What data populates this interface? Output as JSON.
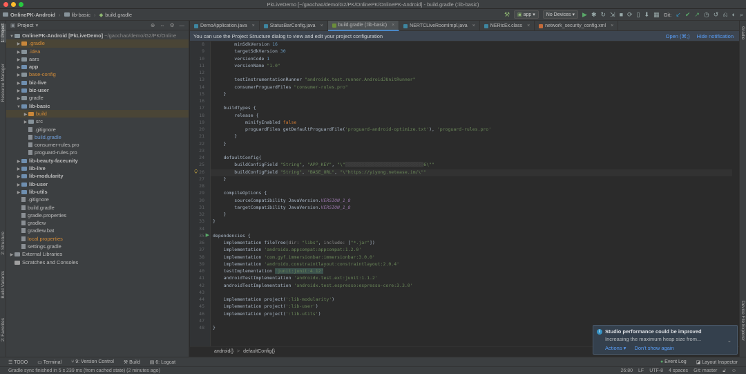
{
  "window": {
    "title": "PkLiveDemo [~/gaochao/demo/G2/PK/OnlinePK/OnlinePK-Android] - build.gradle (:lib-basic)"
  },
  "navbar": {
    "breadcrumbs": [
      "OnlinePK-Android",
      "lib-basic",
      "build.gradle"
    ],
    "run_config": "app",
    "device": "No Devices",
    "git_label": "Git:"
  },
  "left_tool_tabs": [
    "1: Project",
    "Resource Manager",
    "2: Structure",
    "Build Variants",
    "2: Favorites"
  ],
  "right_tool_tabs": [
    "Gradle",
    "Device File Explorer"
  ],
  "project": {
    "header": "Project",
    "tree": [
      {
        "indent": 0,
        "tw": "▼",
        "icon": "folder",
        "label": "OnlinePK-Android [PkLiveDemo]",
        "suffix": "~/gaochao/demo/G2/PK/Online",
        "bold": true
      },
      {
        "indent": 1,
        "tw": "▶",
        "icon": "folder-orange",
        "label": ".gradle",
        "orange": true,
        "highlight": true
      },
      {
        "indent": 1,
        "tw": "▶",
        "icon": "folder",
        "label": ".idea",
        "orange": true
      },
      {
        "indent": 1,
        "tw": "▶",
        "icon": "folder",
        "label": "aars"
      },
      {
        "indent": 1,
        "tw": "▶",
        "icon": "module",
        "label": "app",
        "bold": true
      },
      {
        "indent": 1,
        "tw": "▶",
        "icon": "folder",
        "label": "base-config",
        "orange": true
      },
      {
        "indent": 1,
        "tw": "▶",
        "icon": "module",
        "label": "biz-live",
        "bold": true
      },
      {
        "indent": 1,
        "tw": "▶",
        "icon": "module",
        "label": "biz-user",
        "bold": true
      },
      {
        "indent": 1,
        "tw": "▶",
        "icon": "folder",
        "label": "gradle"
      },
      {
        "indent": 1,
        "tw": "▼",
        "icon": "module",
        "label": "lib-basic",
        "bold": true
      },
      {
        "indent": 2,
        "tw": "▶",
        "icon": "folder-orange",
        "label": "build",
        "orange": true,
        "highlight": true
      },
      {
        "indent": 2,
        "tw": "▶",
        "icon": "folder",
        "label": "src"
      },
      {
        "indent": 2,
        "tw": "",
        "icon": "file",
        "label": ".gitignore"
      },
      {
        "indent": 2,
        "tw": "",
        "icon": "file",
        "label": "build.gradle",
        "blue": true
      },
      {
        "indent": 2,
        "tw": "",
        "icon": "file",
        "label": "consumer-rules.pro"
      },
      {
        "indent": 2,
        "tw": "",
        "icon": "file",
        "label": "proguard-rules.pro"
      },
      {
        "indent": 1,
        "tw": "▶",
        "icon": "module",
        "label": "lib-beauty-faceunity",
        "bold": true
      },
      {
        "indent": 1,
        "tw": "▶",
        "icon": "module",
        "label": "lib-live",
        "bold": true
      },
      {
        "indent": 1,
        "tw": "▶",
        "icon": "module",
        "label": "lib-modularity",
        "bold": true
      },
      {
        "indent": 1,
        "tw": "▶",
        "icon": "module",
        "label": "lib-user",
        "bold": true
      },
      {
        "indent": 1,
        "tw": "▶",
        "icon": "module",
        "label": "lib-utils",
        "bold": true
      },
      {
        "indent": 1,
        "tw": "",
        "icon": "file",
        "label": ".gitignore"
      },
      {
        "indent": 1,
        "tw": "",
        "icon": "file",
        "label": "build.gradle"
      },
      {
        "indent": 1,
        "tw": "",
        "icon": "file",
        "label": "gradle.properties"
      },
      {
        "indent": 1,
        "tw": "",
        "icon": "file",
        "label": "gradlew"
      },
      {
        "indent": 1,
        "tw": "",
        "icon": "file",
        "label": "gradlew.bat"
      },
      {
        "indent": 1,
        "tw": "",
        "icon": "file",
        "label": "local.properties",
        "orange": true
      },
      {
        "indent": 1,
        "tw": "",
        "icon": "file",
        "label": "settings.gradle"
      },
      {
        "indent": 0,
        "tw": "▶",
        "icon": "lib",
        "label": "External Libraries"
      },
      {
        "indent": 0,
        "tw": "",
        "icon": "scratch",
        "label": "Scratches and Consoles"
      }
    ]
  },
  "tabs": [
    {
      "label": "DemoApplication.java",
      "color": "#3e86a0",
      "active": false
    },
    {
      "label": "StatusBarConfig.java",
      "color": "#3e86a0",
      "active": false
    },
    {
      "label": "build.gradle (:lib-basic)",
      "color": "#6b8e3a",
      "active": true
    },
    {
      "label": "NERTCLiveRoomImpl.java",
      "color": "#3e86a0",
      "active": false
    },
    {
      "label": "NERtcEx.class",
      "color": "#3e86a0",
      "active": false
    },
    {
      "label": "network_security_config.xml",
      "color": "#c46b3a",
      "active": false
    }
  ],
  "notification": {
    "text": "You can use the Project Structure dialog to view and edit your project configuration",
    "open_label": "Open (⌘;)",
    "hide_label": "Hide notification"
  },
  "code_lines": [
    {
      "n": "8",
      "html": "        minSdkVersion <span class=\"num\">16</span>"
    },
    {
      "n": "9",
      "html": "        targetSdkVersion <span class=\"num\">30</span>"
    },
    {
      "n": "10",
      "html": "        versionCode <span class=\"num\">1</span>"
    },
    {
      "n": "11",
      "html": "        versionName <span class=\"str\">\"1.0\"</span>"
    },
    {
      "n": "12",
      "html": ""
    },
    {
      "n": "13",
      "html": "        testInstrumentationRunner <span class=\"str\">\"androidx.test.runner.AndroidJUnitRunner\"</span>"
    },
    {
      "n": "14",
      "html": "        consumerProguardFiles <span class=\"str\">\"consumer-rules.pro\"</span>"
    },
    {
      "n": "15",
      "html": "    }"
    },
    {
      "n": "16",
      "html": ""
    },
    {
      "n": "17",
      "html": "    buildTypes {"
    },
    {
      "n": "18",
      "html": "        release {"
    },
    {
      "n": "19",
      "html": "            minifyEnabled <span class=\"kw\">false</span>"
    },
    {
      "n": "20",
      "html": "            proguardFiles getDefaultProguardFile(<span class=\"str\">'proguard-android-optimize.txt'</span>), <span class=\"str\">'proguard-rules.pro'</span>"
    },
    {
      "n": "21",
      "html": "        }"
    },
    {
      "n": "22",
      "html": "    }"
    },
    {
      "n": "23",
      "html": ""
    },
    {
      "n": "24",
      "html": "    defaultConfig{"
    },
    {
      "n": "25",
      "html": "        buildConfigField <span class=\"str\">\"String\"</span>, <span class=\"str\">\"APP_KEY\"</span>, <span class=\"str\">\"\\\"<span style=\"color:#4a4a4a\">▒▒▒▒▒▒▒▒▒▒▒▒▒▒▒▒▒▒▒▒▒▒▒▒▒▒▒▒▒</span>6\\\"\"</span>"
    },
    {
      "n": "26",
      "html": "        buildConfigField <span class=\"str\">\"String\"</span>, <span class=\"str\">\"BASE_URL\"</span>, <span class=\"str\">\"\\\"https://yiyong.netease.im/\\\"\"</span>",
      "current": true
    },
    {
      "n": "27",
      "html": "    }"
    },
    {
      "n": "28",
      "html": ""
    },
    {
      "n": "29",
      "html": "    compileOptions {"
    },
    {
      "n": "30",
      "html": "        sourceCompatibility JavaVersion.<span class=\"itl\">VERSION_1_8</span>"
    },
    {
      "n": "31",
      "html": "        targetCompatibility JavaVersion.<span class=\"itl\">VERSION_1_8</span>"
    },
    {
      "n": "32",
      "html": "    }"
    },
    {
      "n": "33",
      "html": "}"
    },
    {
      "n": "34",
      "html": ""
    },
    {
      "n": "35",
      "html": "dependencies {"
    },
    {
      "n": "36",
      "html": "    implementation fileTree(<span class=\"muted\">dir:</span> <span class=\"str\">\"libs\"</span>, <span class=\"muted\">include:</span> [<span class=\"str\">\"*.jar\"</span>])"
    },
    {
      "n": "37",
      "html": "    implementation <span class=\"str\">'androidx.appcompat:appcompat:1.2.0'</span>"
    },
    {
      "n": "38",
      "html": "    implementation <span class=\"str\">'com.gyf.immersionbar:immersionbar:3.0.0'</span>"
    },
    {
      "n": "39",
      "html": "    implementation <span class=\"str\">'androidx.constraintlayout:constraintlayout:2.0.4'</span>"
    },
    {
      "n": "40",
      "html": "    testImplementation <span class=\"str hlstr\">'junit:junit:4.12'</span>"
    },
    {
      "n": "41",
      "html": "    androidTestImplementation <span class=\"str\">'androidx.test.ext:junit:1.1.2'</span>"
    },
    {
      "n": "42",
      "html": "    androidTestImplementation <span class=\"str\">'androidx.test.espresso:espresso-core:3.3.0'</span>"
    },
    {
      "n": "43",
      "html": ""
    },
    {
      "n": "44",
      "html": "    implementation project(<span class=\"str\">':lib-modularity'</span>)"
    },
    {
      "n": "45",
      "html": "    implementation project(<span class=\"str\">':lib-user'</span>)"
    },
    {
      "n": "46",
      "html": "    implementation project(<span class=\"str\">':lib-utils'</span>)"
    },
    {
      "n": "47",
      "html": ""
    },
    {
      "n": "48",
      "html": "}"
    }
  ],
  "editor_breadcrumb": [
    "android{}",
    "defaultConfig{}"
  ],
  "bottom_tabs": [
    "TODO",
    "Terminal",
    "9: Version Control",
    "Build",
    "6: Logcat"
  ],
  "bottom_tabs_right": [
    "Event Log",
    "Layout Inspector"
  ],
  "status": {
    "message": "Gradle sync finished in 5 s 239 ms (from cached state) (2 minutes ago)",
    "position": "26:80",
    "line_sep": "LF",
    "encoding": "UTF-8",
    "indent": "4 spaces",
    "vcs": "Git: master"
  },
  "balloon": {
    "title": "Studio performance could be improved",
    "body": "Increasing the maximum heap size from...",
    "action1": "Actions ▾",
    "action2": "Don't show again"
  }
}
